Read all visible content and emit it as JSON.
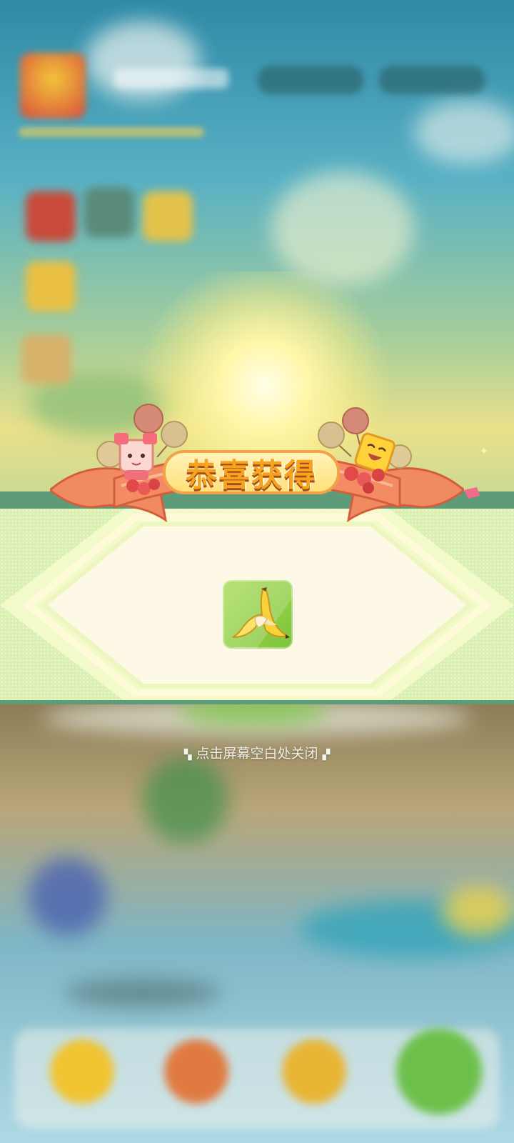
{
  "popup": {
    "title": "恭喜获得",
    "reward": {
      "icon": "banana-icon"
    },
    "close_hint": "点击屏幕空白处关闭"
  },
  "colors": {
    "band": "#d9f0b0",
    "band_dark": "#5e9b78",
    "panel": "#fdf9e6",
    "ribbon": "#f28a64",
    "title_text": "#f6a41d",
    "item_bg": "#8ccb44"
  }
}
